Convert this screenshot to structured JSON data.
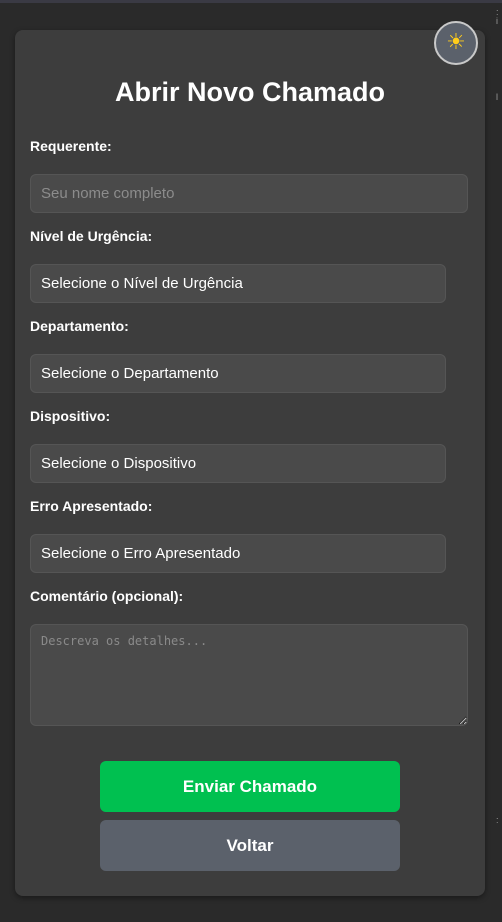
{
  "theme_toggle": {
    "icon": "sun-icon",
    "glyph": "☀"
  },
  "title": "Abrir Novo Chamado",
  "fields": {
    "requerente": {
      "label": "Requerente:",
      "value": "",
      "placeholder": "Seu nome completo"
    },
    "urgencia": {
      "label": "Nível de Urgência:",
      "selected": "Selecione o Nível de Urgência"
    },
    "departamento": {
      "label": "Departamento:",
      "selected": "Selecione o Departamento"
    },
    "dispositivo": {
      "label": "Dispositivo:",
      "selected": "Selecione o Dispositivo"
    },
    "erro": {
      "label": "Erro Apresentado:",
      "selected": "Selecione o Erro Apresentado"
    },
    "comentario": {
      "label": "Comentário (opcional):",
      "value": "",
      "placeholder": "Descreva os detalhes..."
    }
  },
  "buttons": {
    "submit": "Enviar Chamado",
    "back": "Voltar"
  },
  "colors": {
    "page_background": "#2a2a2a",
    "card_background": "#3d3d3d",
    "input_background": "#4a4a4a",
    "submit_button": "#00c050",
    "back_button": "#5b616b",
    "sun_icon": "#ffcc1a"
  }
}
